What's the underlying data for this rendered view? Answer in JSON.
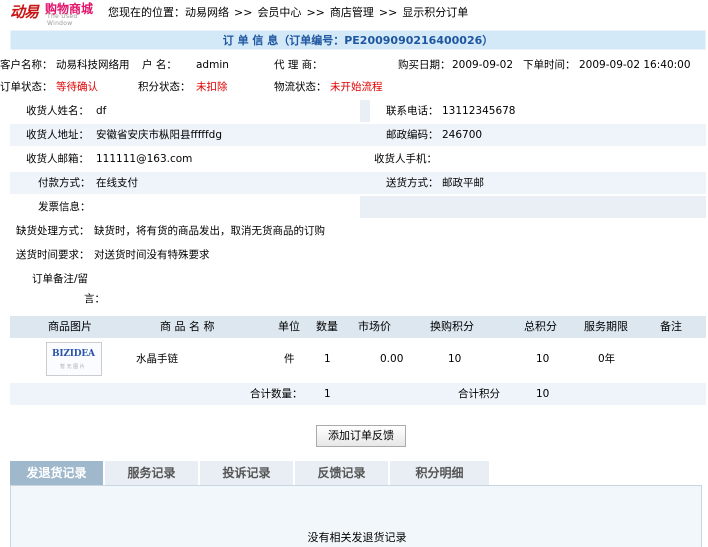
{
  "logo": {
    "main": "动易",
    "name": "购物商城",
    "sub": "The Used Window"
  },
  "breadcrumb": {
    "prefix": "您现在的位置：",
    "items": [
      "动易网络",
      "会员中心",
      "商店管理",
      "显示积分订单"
    ],
    "sep": ">>"
  },
  "order": {
    "title": "订 单 信 息（订单编号：PE2009090216400026）",
    "customer_label": "客户名称：",
    "customer": "动易科技网络用",
    "username_label": "户 名：",
    "username": "admin",
    "agent_label": "代 理 商：",
    "agent": "",
    "buy_date_label": "购买日期：",
    "buy_date": "2009-09-02",
    "order_time_label": "下单时间：",
    "order_time": "2009-09-02 16:40:00",
    "status_label": "订单状态：",
    "status": "等待确认",
    "points_status_label": "积分状态：",
    "points_status": "未扣除",
    "logistics_label": "物流状态：",
    "logistics": "未开始流程"
  },
  "receiver": {
    "name_label": "收货人姓名：",
    "name": "df",
    "phone_label": "联系电话：",
    "phone": "13112345678",
    "address_label": "收货人地址：",
    "address": "安徽省安庆市枞阳县fffffdg",
    "zip_label": "邮政编码：",
    "zip": "246700",
    "email_label": "收货人邮箱：",
    "email": "111111@163.com",
    "mobile_label": "收货人手机：",
    "mobile": "",
    "payment_label": "付款方式：",
    "payment": "在线支付",
    "delivery_label": "送货方式：",
    "delivery": "邮政平邮",
    "invoice_label": "发票信息：",
    "invoice": "",
    "shortage_label": "缺货处理方式：",
    "shortage": "缺货时，将有货的商品发出，取消无货商品的订购",
    "delivery_time_label": "送货时间要求：",
    "delivery_time": "对送货时间没有特殊要求",
    "remark_label_1": "订单备注/留",
    "remark_label_2": "言：",
    "remark": ""
  },
  "products": {
    "headers": [
      "商品图片",
      "商 品 名 称",
      "单位",
      "数量",
      "市场价",
      "换购积分",
      "总积分",
      "服务期限",
      "备注"
    ],
    "rows": [
      {
        "image_text": "BIZIDEA",
        "image_sub": "暂 无 图 片",
        "name": "水晶手链",
        "unit": "件",
        "qty": "1",
        "market_price": "0.00",
        "points": "10",
        "total_points": "10",
        "service": "0年",
        "note": ""
      }
    ],
    "sum_qty_label": "合计数量：",
    "sum_qty": "1",
    "sum_points_label": "合计积分",
    "sum_points": "10"
  },
  "feedback_button": "添加订单反馈",
  "tabs": [
    "发退货记录",
    "服务记录",
    "投诉记录",
    "反馈记录",
    "积分明细"
  ],
  "tab_empty_message": "没有相关发退货记录"
}
